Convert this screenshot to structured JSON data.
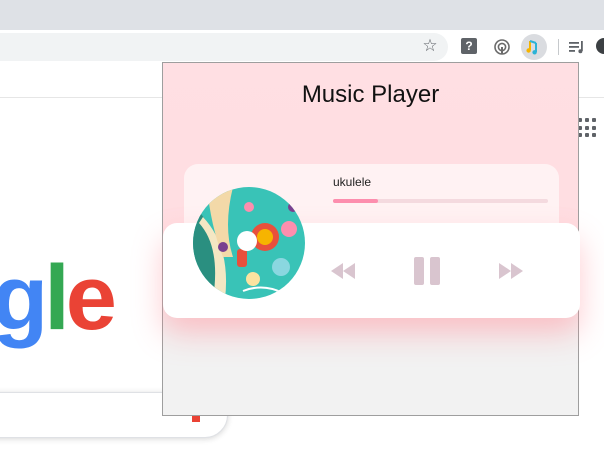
{
  "toolbar": {
    "help_glyph": "?",
    "star_glyph": "☆"
  },
  "google_logo_fragment": [
    "g",
    "l",
    "e"
  ],
  "popup": {
    "title": "Music Player",
    "track_name": "ukulele",
    "progress": 0.21,
    "controls": {
      "prev_icon": "rewind-icon",
      "play_state_icon": "pause-icon",
      "next_icon": "fast-forward-icon"
    },
    "accent_pink": "#fd8eae",
    "control_color": "#d9c5cf"
  }
}
